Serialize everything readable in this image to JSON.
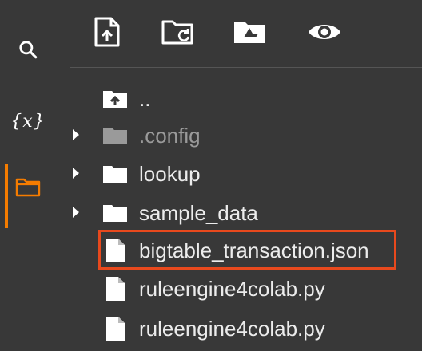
{
  "sidebar": {
    "items": [
      {
        "icon": "search-icon"
      },
      {
        "icon": "variables-icon",
        "label": "{x}"
      },
      {
        "icon": "folder-icon",
        "active": true
      }
    ]
  },
  "toolbar": {
    "buttons": [
      {
        "icon": "upload-file-icon"
      },
      {
        "icon": "refresh-folder-icon"
      },
      {
        "icon": "mount-drive-icon"
      },
      {
        "icon": "eye-icon"
      }
    ]
  },
  "files": {
    "parent": "..",
    "items": [
      {
        "name": ".config",
        "type": "folder",
        "expandable": true,
        "dimmed": true
      },
      {
        "name": "lookup",
        "type": "folder",
        "expandable": true
      },
      {
        "name": "sample_data",
        "type": "folder",
        "expandable": true
      },
      {
        "name": "bigtable_transaction.json",
        "type": "file",
        "highlighted": true
      },
      {
        "name": "ruleengine4colab.py",
        "type": "file"
      },
      {
        "name": "ruleengine4colab.py",
        "type": "file"
      }
    ]
  },
  "colors": {
    "background": "#383838",
    "accent": "#f57c00",
    "highlight_border": "#e8491d"
  }
}
